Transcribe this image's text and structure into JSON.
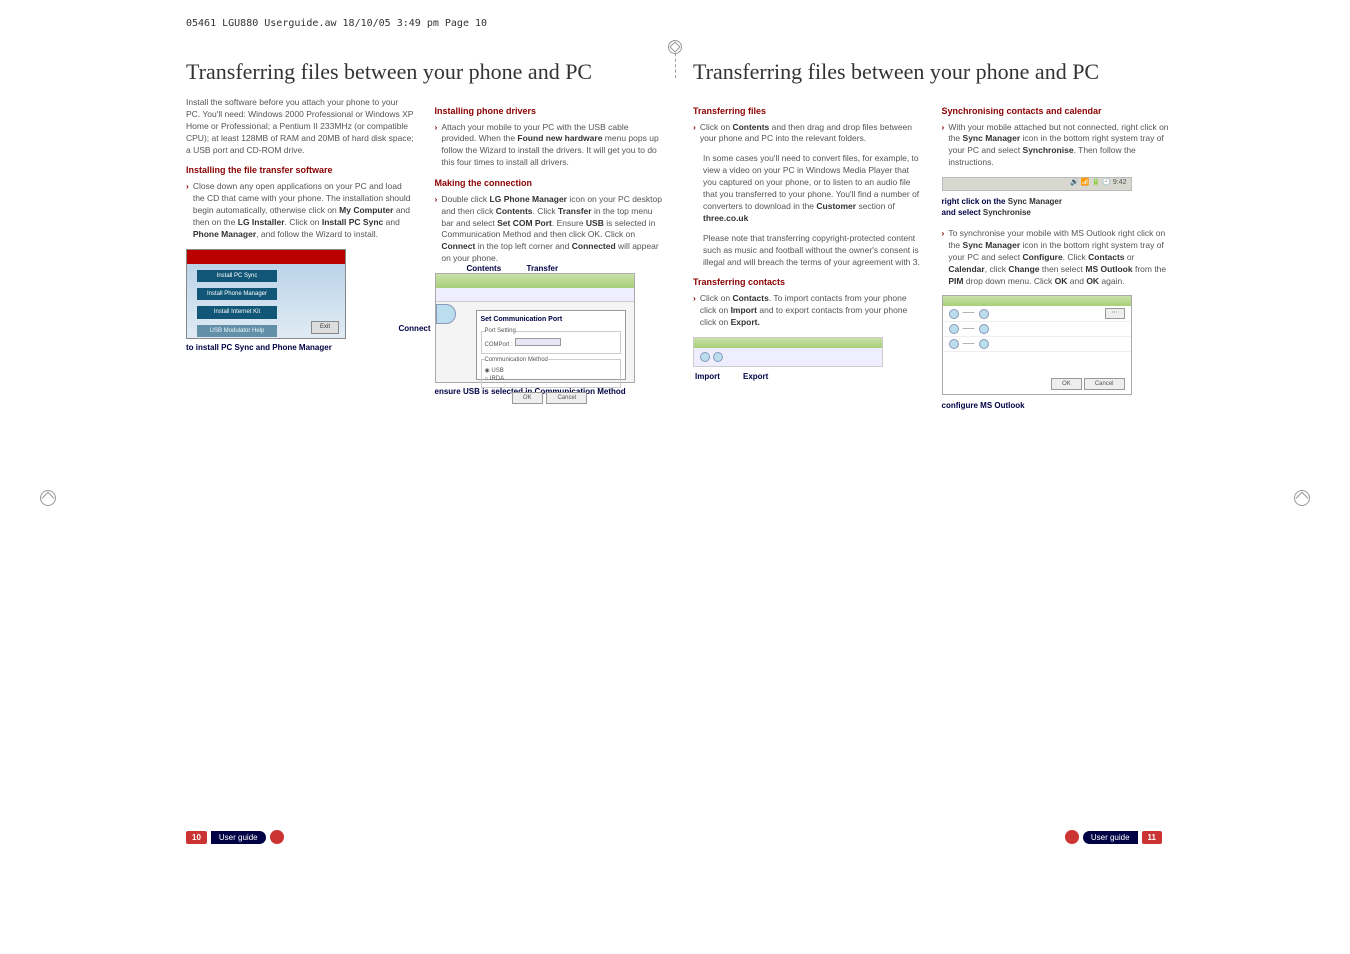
{
  "header": "05461 LGU880 Userguide.aw  18/10/05  3:49 pm  Page 10",
  "title_left": "Transferring files between your phone and PC",
  "title_right": "Transferring files between your phone and PC",
  "left": {
    "col1": {
      "intro": "Install the software before you attach your phone to your PC. You'll need: Windows 2000 Professional or Windows XP Home or Professional; a Pentium II 233MHz (or compatible CPU); at least 128MB of RAM and 20MB of hard disk space; a USB port and CD-ROM drive.",
      "h1": "Installing the file transfer software",
      "p1_pre": "Close down any open applications on your PC and load the CD that came with your phone. The installation should begin automatically, otherwise click on ",
      "my_computer": "My Computer",
      "p1_mid": " and then on the ",
      "lg_installer": "LG Installer",
      "p1_mid2": ". Click on ",
      "install_pc_sync": "Install PC Sync",
      "p1_mid3": " and ",
      "phone_manager": "Phone Manager",
      "p1_end": ", and follow the Wizard to install.",
      "fig": {
        "btn1": "Install PC Sync",
        "btn2": "Install Phone Manager",
        "btn3": "Install Internet Kit",
        "btn4": "USB Modulator Help",
        "exit": "Exit"
      },
      "cap": "to install PC Sync and Phone Manager"
    },
    "col2": {
      "h1": "Installing phone drivers",
      "p1_pre": "Attach your mobile to your PC with the USB cable provided. When the ",
      "found_new": "Found new hardware",
      "p1_end": " menu pops up follow the Wizard to install the drivers. It will get you to do this four times to install all drivers.",
      "h2": "Making the connection",
      "p2_pre": "Double click ",
      "lg_phone_mgr": "LG Phone Manager",
      "p2_a": " icon on your PC desktop and then click ",
      "contents": "Contents",
      "p2_b": ". Click ",
      "transfer": "Transfer",
      "p2_c": " in the top menu bar and select ",
      "set_com": "Set COM Port",
      "p2_d": ". Ensure ",
      "usb": "USB",
      "p2_e": " is selected in Communication Method and then click OK. Click on ",
      "connect": "Connect",
      "p2_f": " in the top left corner and ",
      "connected": "Connected",
      "p2_g": " will appear on your phone.",
      "anno_contents": "Contents",
      "anno_transfer": "Transfer",
      "anno_connect": "Connect",
      "panel": {
        "title": "Set Communication Port",
        "port": "Port Setting",
        "comport": "COMPort :",
        "method": "Communication Method",
        "usb_opt": "USB",
        "irda_opt": "IRDA",
        "ok": "OK",
        "cancel": "Cancel"
      },
      "cap": "ensure USB is selected in Communication Method"
    }
  },
  "right": {
    "col1": {
      "h1": "Transferring files",
      "p1_pre": "Click on ",
      "contents": "Contents",
      "p1_end": " and then drag and drop files between your phone and PC into the relevant folders.",
      "p2_a": "In some cases you'll need to convert files, for example, to view a video on your PC in Windows Media Player that you captured on your phone, or to listen to an audio file that you transferred to your phone. You'll find a number of converters to download in the ",
      "customer": "Customer",
      "p2_b": " section of ",
      "three_url": "three.co.uk",
      "p3": "Please note that transferring copyright-protected content such as music and football without the owner's consent is illegal and will breach the terms of your agreement with 3.",
      "h2": "Transferring contacts",
      "p4_pre": "Click on ",
      "contacts": "Contacts",
      "p4_a": ". To import contacts from your phone click on ",
      "import": "Import",
      "p4_b": " and to export contacts from your phone click on ",
      "export": "Export.",
      "anno_import": "Import",
      "anno_export": "Export"
    },
    "col2": {
      "h1": "Synchronising contacts and calendar",
      "p1_pre": "With your mobile attached but not connected, right click on the ",
      "sync_mgr": "Sync Manager",
      "p1_a": " icon in the bottom right system tray of your PC and select ",
      "synchronise": "Synchronise",
      "p1_end": ". Then follow the instructions.",
      "tray_time": "9:42",
      "cap1_a": "right click on the ",
      "cap1_b": "Sync Manager",
      "cap1_c": " and select ",
      "cap1_d": "Synchronise",
      "p2_pre": "To synchronise your mobile with MS Outlook right click on the ",
      "p2_a": " icon in the bottom right system tray of your PC and select ",
      "configure": "Configure",
      "p2_b": ". Click ",
      "contacts2": "Contacts",
      "p2_c": " or ",
      "calendar": "Calendar",
      "p2_d": ", click ",
      "change": "Change",
      "p2_e": " then select ",
      "ms_outlook": "MS Outlook",
      "p2_f": " from the ",
      "pim": "PIM",
      "p2_g": " drop down menu. Click ",
      "ok": "OK",
      "p2_h": " and ",
      "p2_i": " again.",
      "cap2": "configure MS Outlook"
    }
  },
  "footer_left_num": "10",
  "footer_right_num": "11",
  "footer_label": "User guide"
}
